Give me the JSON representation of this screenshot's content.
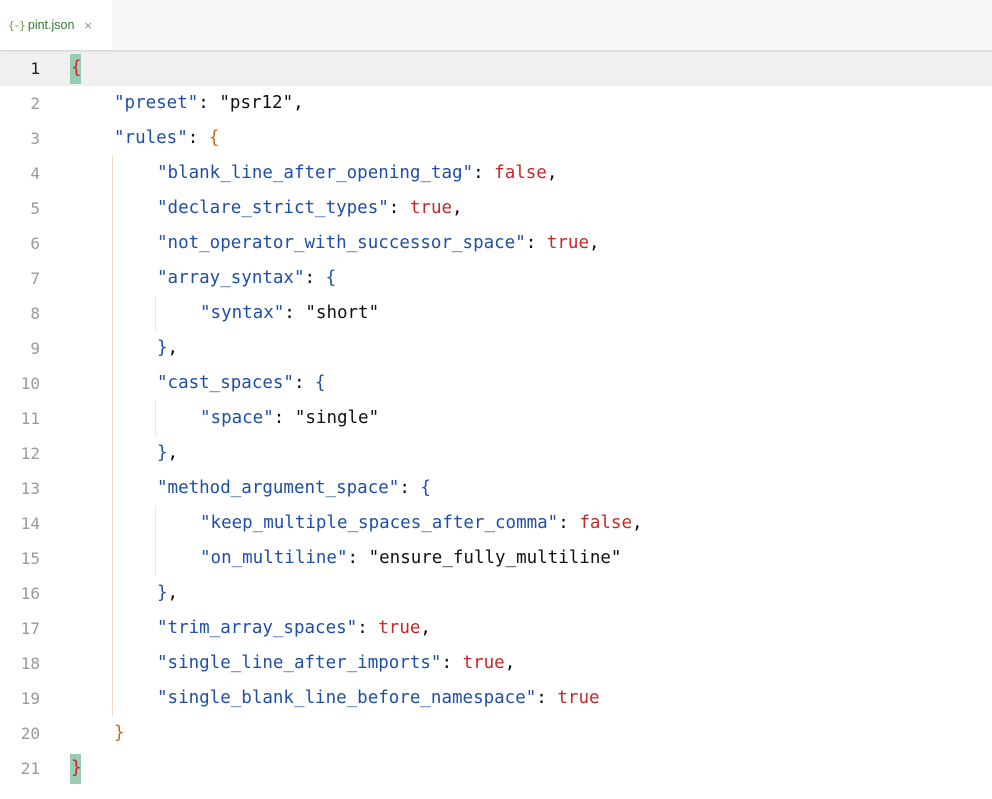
{
  "tab": {
    "icon": "{-}",
    "label": "pint.json",
    "close": "×"
  },
  "editor": {
    "current_line": 1,
    "line_numbers": [
      "1",
      "2",
      "3",
      "4",
      "5",
      "6",
      "7",
      "8",
      "9",
      "10",
      "11",
      "12",
      "13",
      "14",
      "15",
      "16",
      "17",
      "18",
      "19",
      "20",
      "21"
    ],
    "lines": [
      [
        {
          "t": "{",
          "c": "brace-outer"
        }
      ],
      [
        {
          "t": "\"preset\"",
          "c": "key2"
        },
        {
          "t": ": ",
          "c": "punc"
        },
        {
          "t": "\"psr12\"",
          "c": "str-dark"
        },
        {
          "t": ",",
          "c": "punc"
        }
      ],
      [
        {
          "t": "\"rules\"",
          "c": "key2"
        },
        {
          "t": ": ",
          "c": "punc"
        },
        {
          "t": "{",
          "c": "brace-rules"
        }
      ],
      [
        {
          "t": "\"blank_line_after_opening_tag\"",
          "c": "key2"
        },
        {
          "t": ": ",
          "c": "punc"
        },
        {
          "t": "false",
          "c": "bool"
        },
        {
          "t": ",",
          "c": "punc"
        }
      ],
      [
        {
          "t": "\"declare_strict_types\"",
          "c": "key2"
        },
        {
          "t": ": ",
          "c": "punc"
        },
        {
          "t": "true",
          "c": "bool"
        },
        {
          "t": ",",
          "c": "punc"
        }
      ],
      [
        {
          "t": "\"not_operator_with_successor_space\"",
          "c": "key2"
        },
        {
          "t": ": ",
          "c": "punc"
        },
        {
          "t": "true",
          "c": "bool"
        },
        {
          "t": ",",
          "c": "punc"
        }
      ],
      [
        {
          "t": "\"array_syntax\"",
          "c": "key2"
        },
        {
          "t": ": ",
          "c": "punc"
        },
        {
          "t": "{",
          "c": "brace-inner"
        }
      ],
      [
        {
          "t": "\"syntax\"",
          "c": "key2"
        },
        {
          "t": ": ",
          "c": "punc"
        },
        {
          "t": "\"short\"",
          "c": "str-dark"
        }
      ],
      [
        {
          "t": "}",
          "c": "brace-inner"
        },
        {
          "t": ",",
          "c": "punc"
        }
      ],
      [
        {
          "t": "\"cast_spaces\"",
          "c": "key2"
        },
        {
          "t": ": ",
          "c": "punc"
        },
        {
          "t": "{",
          "c": "brace-inner"
        }
      ],
      [
        {
          "t": "\"space\"",
          "c": "key2"
        },
        {
          "t": ": ",
          "c": "punc"
        },
        {
          "t": "\"single\"",
          "c": "str-dark"
        }
      ],
      [
        {
          "t": "}",
          "c": "brace-inner"
        },
        {
          "t": ",",
          "c": "punc"
        }
      ],
      [
        {
          "t": "\"method_argument_space\"",
          "c": "key2"
        },
        {
          "t": ": ",
          "c": "punc"
        },
        {
          "t": "{",
          "c": "brace-inner"
        }
      ],
      [
        {
          "t": "\"keep_multiple_spaces_after_comma\"",
          "c": "key2"
        },
        {
          "t": ": ",
          "c": "punc"
        },
        {
          "t": "false",
          "c": "bool"
        },
        {
          "t": ",",
          "c": "punc"
        }
      ],
      [
        {
          "t": "\"on_multiline\"",
          "c": "key2"
        },
        {
          "t": ": ",
          "c": "punc"
        },
        {
          "t": "\"ensure_fully_multiline\"",
          "c": "str-dark"
        }
      ],
      [
        {
          "t": "}",
          "c": "brace-inner"
        },
        {
          "t": ",",
          "c": "punc"
        }
      ],
      [
        {
          "t": "\"trim_array_spaces\"",
          "c": "key2"
        },
        {
          "t": ": ",
          "c": "punc"
        },
        {
          "t": "true",
          "c": "bool"
        },
        {
          "t": ",",
          "c": "punc"
        }
      ],
      [
        {
          "t": "\"single_line_after_imports\"",
          "c": "key2"
        },
        {
          "t": ": ",
          "c": "punc"
        },
        {
          "t": "true",
          "c": "bool"
        },
        {
          "t": ",",
          "c": "punc"
        }
      ],
      [
        {
          "t": "\"single_blank_line_before_namespace\"",
          "c": "key2"
        },
        {
          "t": ": ",
          "c": "punc"
        },
        {
          "t": "true",
          "c": "bool"
        }
      ],
      [
        {
          "t": "}",
          "c": "brace-rules"
        }
      ],
      [
        {
          "t": "}",
          "c": "brace-outer"
        }
      ]
    ],
    "indents": [
      0,
      1,
      1,
      2,
      2,
      2,
      2,
      3,
      2,
      2,
      3,
      2,
      2,
      3,
      3,
      2,
      2,
      2,
      2,
      1,
      0
    ]
  }
}
